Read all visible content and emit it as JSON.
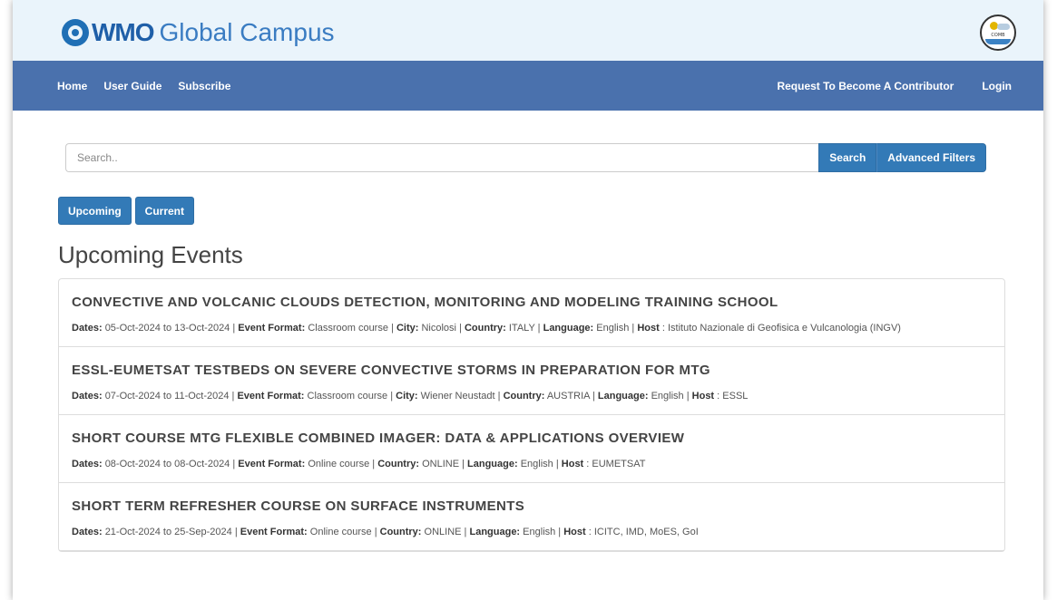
{
  "header": {
    "logo_strong": "WMO",
    "logo_light": "Global Campus",
    "partner_logo_text": "COMB"
  },
  "nav": {
    "left": [
      "Home",
      "User Guide",
      "Subscribe"
    ],
    "right": [
      "Request To Become A Contributor",
      "Login"
    ]
  },
  "search": {
    "placeholder": "Search..",
    "search_label": "Search",
    "advanced_label": "Advanced Filters"
  },
  "tabs": [
    "Upcoming",
    "Current"
  ],
  "section_title": "Upcoming Events",
  "labels": {
    "dates": "Dates:",
    "to": "to",
    "format": "Event Format:",
    "city": "City:",
    "country": "Country:",
    "language": "Language:",
    "host": "Host"
  },
  "events": [
    {
      "title": "CONVECTIVE AND VOLCANIC CLOUDS DETECTION, MONITORING AND MODELING TRAINING SCHOOL",
      "start": "05-Oct-2024",
      "end": "13-Oct-2024",
      "format": "Classroom course",
      "city": "Nicolosi",
      "country": "ITALY",
      "language": "English",
      "host": "Istituto Nazionale di Geofisica e Vulcanologia (INGV)"
    },
    {
      "title": "ESSL-EUMETSAT TESTBEDS ON SEVERE CONVECTIVE STORMS IN PREPARATION FOR MTG",
      "start": "07-Oct-2024",
      "end": "11-Oct-2024",
      "format": "Classroom course",
      "city": "Wiener Neustadt",
      "country": "AUSTRIA",
      "language": "English",
      "host": "ESSL"
    },
    {
      "title": "SHORT COURSE MTG FLEXIBLE COMBINED IMAGER: DATA & APPLICATIONS OVERVIEW",
      "start": "08-Oct-2024",
      "end": "08-Oct-2024",
      "format": "Online course",
      "city": "",
      "country": "ONLINE",
      "language": "English",
      "host": "EUMETSAT"
    },
    {
      "title": "SHORT TERM REFRESHER COURSE ON SURFACE INSTRUMENTS",
      "start": "21-Oct-2024",
      "end": "25-Sep-2024",
      "format": "Online course",
      "city": "",
      "country": "ONLINE",
      "language": "English",
      "host": "ICITC, IMD, MoES, GoI"
    }
  ]
}
